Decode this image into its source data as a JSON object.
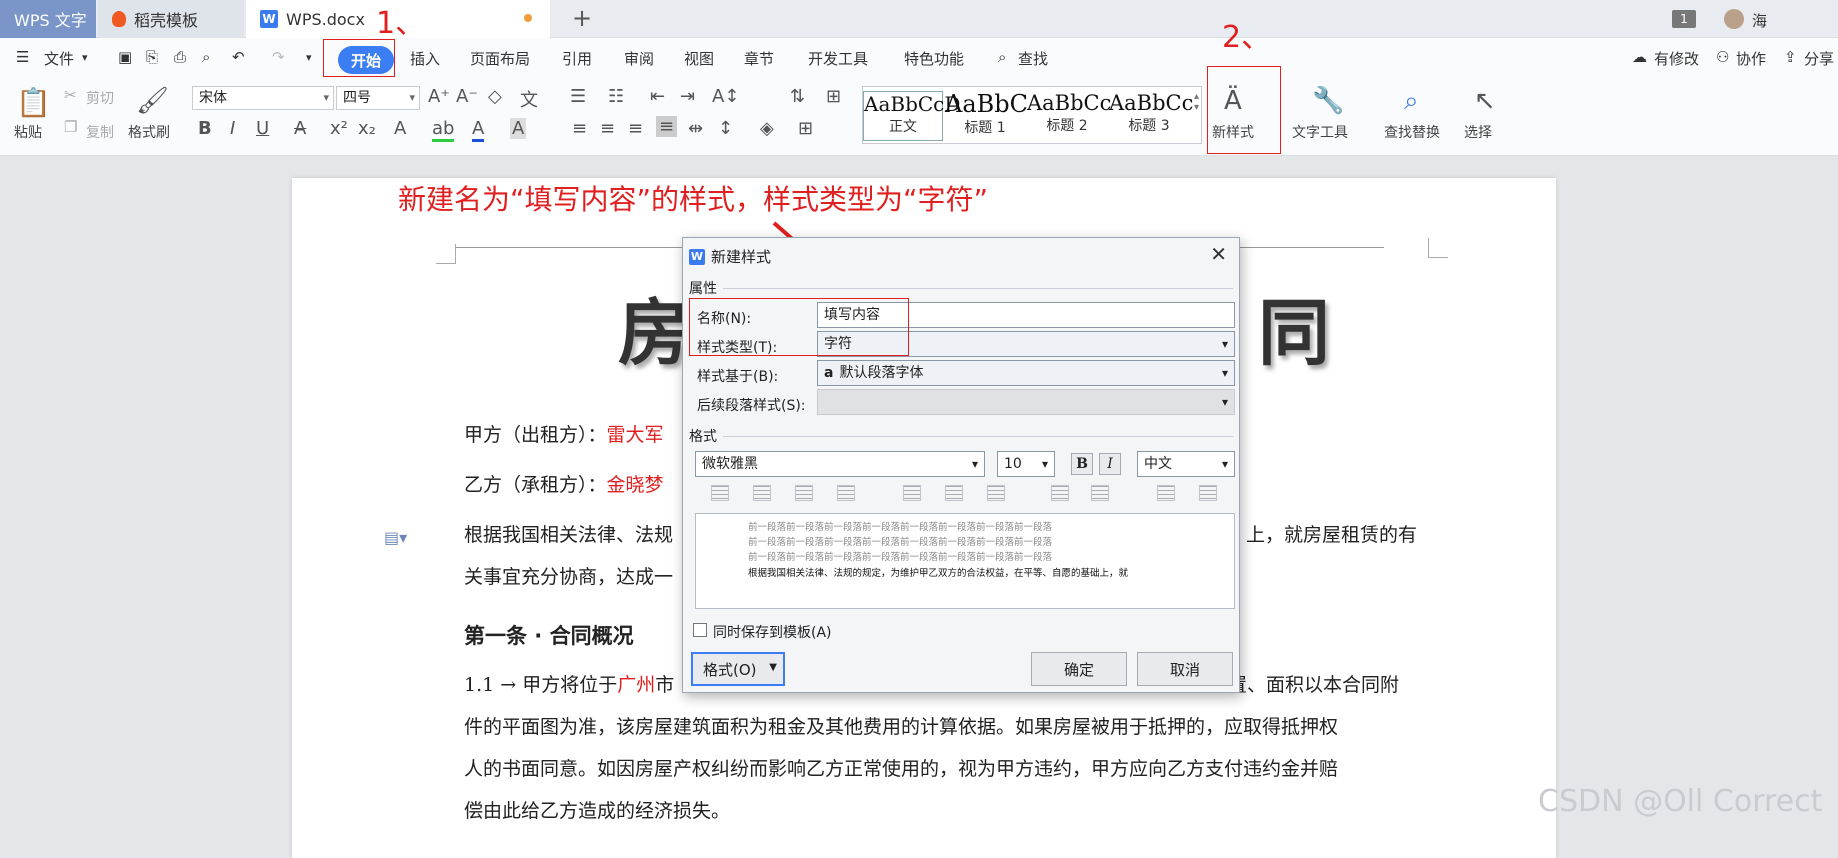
{
  "tabs": {
    "app": "WPS 文字",
    "template": "稻壳模板",
    "doc": "WPS.docx",
    "count": "1",
    "user": "海"
  },
  "menu": {
    "file": "文件",
    "items": [
      "开始",
      "插入",
      "页面布局",
      "引用",
      "审阅",
      "视图",
      "章节",
      "开发工具",
      "特色功能",
      "查找"
    ],
    "right": [
      "有修改",
      "协作",
      "分享"
    ]
  },
  "ribbon": {
    "paste": "粘贴",
    "cut": "剪切",
    "copy": "复制",
    "format_painter": "格式刷",
    "font": "宋体",
    "size": "四号",
    "styles": [
      {
        "preview": "AaBbCcD",
        "name": "正文"
      },
      {
        "preview": "AaBbC",
        "name": "标题 1"
      },
      {
        "preview": "AaBbCc",
        "name": "标题 2"
      },
      {
        "preview": "AaBbCc",
        "name": "标题 3"
      }
    ],
    "new_style": "新样式",
    "text_tools": "文字工具",
    "find_replace": "查找替换",
    "select": "选择"
  },
  "annotations": {
    "step1": "1、",
    "step2": "2、",
    "instruction": "新建名为“填写内容”的样式，样式类型为“字符”"
  },
  "document": {
    "title_char": "房",
    "title_tail": "同",
    "party_a_label": "甲方（出租方）：",
    "party_a_name": "雷大军",
    "party_b_label": "乙方（承租方）：",
    "party_b_name": "金晓梦",
    "para1_start": "根据我国相关法律、法规",
    "para1_end": "上，就房屋租赁的有",
    "para1_line2": "关事宜充分协商，达成一",
    "section1": "第一条 · 合同概况",
    "clause_num": "1.1 →",
    "clause_text_a": "甲方将位于",
    "clause_city": "广州",
    "clause_text_b": "市",
    "clause_text_c": "置、面积以本合同附",
    "line2": "件的平面图为准，该房屋建筑面积为租金及其他费用的计算依据。如果房屋被用于抵押的，应取得抵押权",
    "line3": "人的书面同意。如因房屋产权纠纷而影响乙方正常使用的，视为甲方违约，甲方应向乙方支付违约金并赔",
    "line4": "偿由此给乙方造成的经济损失。"
  },
  "dialog": {
    "title": "新建样式",
    "props_section": "属性",
    "name_label": "名称(N):",
    "name_value": "填写内容",
    "type_label": "样式类型(T):",
    "type_value": "字符",
    "based_label": "样式基于(B):",
    "based_value": "默认段落字体",
    "next_label": "后续段落样式(S):",
    "format_section": "格式",
    "font_value": "微软雅黑",
    "size_value": "10",
    "bold": "B",
    "italic": "I",
    "lang_value": "中文",
    "preview_prev": "前一段落前一段落前一段落前一段落前一段落前一段落前一段落前一段落",
    "preview_sample": "根据我国相关法律、法规的规定，为维护甲乙双方的合法权益，在平等、自愿的基础上，就",
    "save_template": "同时保存到模板(A)",
    "format_btn": "格式(O)",
    "ok": "确定",
    "cancel": "取消"
  },
  "watermark": "CSDN @Oll Correct"
}
